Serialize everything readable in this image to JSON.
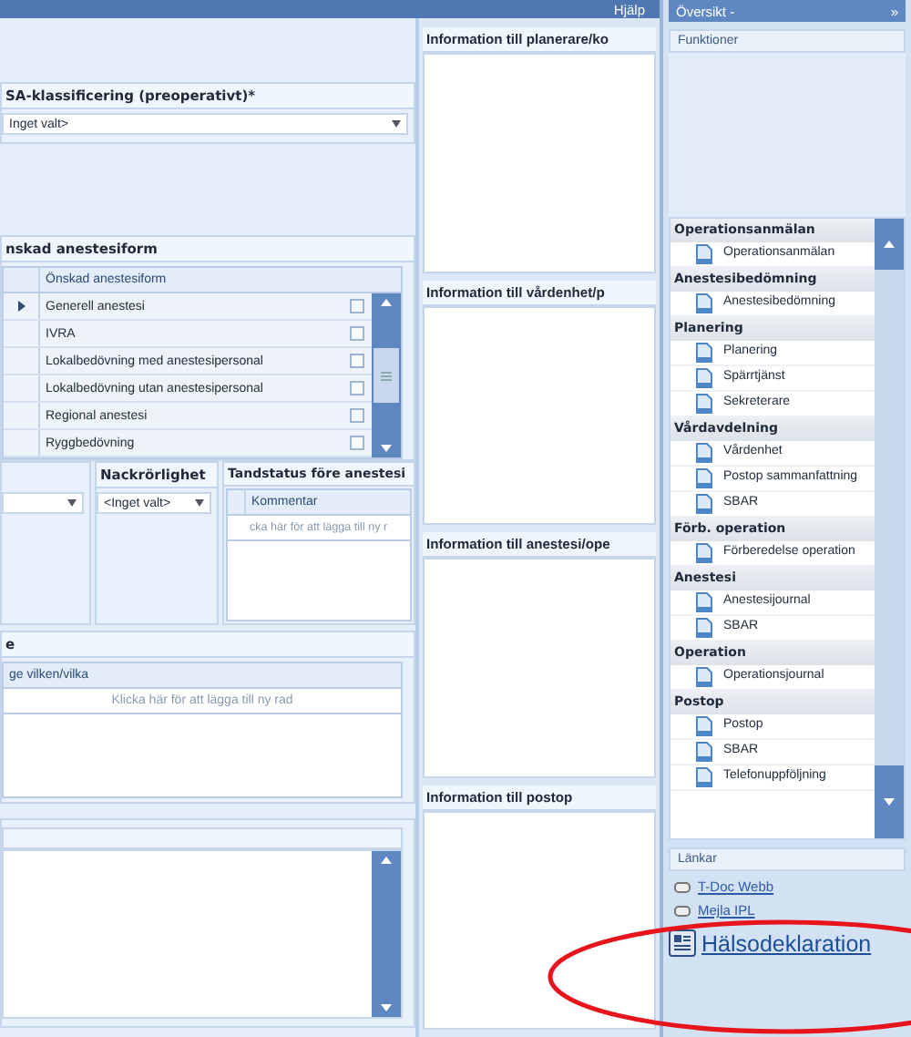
{
  "title_bar": {
    "menu": "Hjälp"
  },
  "asa": {
    "label": "SA-klassificering (preoperativt)*",
    "value": "Inget valt>"
  },
  "anesthesia_form": {
    "label": "nskad anestesiform",
    "column": "Önskad anestesiform",
    "rows": [
      {
        "name": "Generell anestesi",
        "current": true,
        "checked": false
      },
      {
        "name": "IVRA",
        "current": false,
        "checked": false
      },
      {
        "name": "Lokalbedövning med anestesipersonal",
        "current": false,
        "checked": false
      },
      {
        "name": "Lokalbedövning utan anestesipersonal",
        "current": false,
        "checked": false
      },
      {
        "name": "Regional anestesi",
        "current": false,
        "checked": false
      },
      {
        "name": "Ryggbedövning",
        "current": false,
        "checked": false
      }
    ]
  },
  "neck": {
    "label": "Nackrörlighet",
    "value": "<Inget valt>"
  },
  "teeth": {
    "label": "Tandstatus före anestesi",
    "column": "Kommentar",
    "new_row": "cka här för att lägga till ny r"
  },
  "section_e": {
    "label": "e",
    "column": "ge vilken/vilka",
    "new_row": "Klicka här för att lägga till ny rad"
  },
  "info_panels": [
    {
      "title": "Information till planerare/ko"
    },
    {
      "title": "Information till vårdenhet/p"
    },
    {
      "title": "Information till anestesi/ope"
    },
    {
      "title": "Information till postop"
    }
  ],
  "sidebar": {
    "header": "Översikt -",
    "expand": "»",
    "functions": "Funktioner",
    "groups": [
      {
        "title": "Operationsanmälan",
        "items": [
          "Operationsanmälan"
        ]
      },
      {
        "title": "Anestesibedömning",
        "items": [
          "Anestesibedömning"
        ]
      },
      {
        "title": "Planering",
        "items": [
          "Planering",
          "Spärrtjänst",
          "Sekreterare"
        ]
      },
      {
        "title": "Vårdavdelning",
        "items": [
          "Vårdenhet",
          "Postop sammanfattning",
          "SBAR"
        ]
      },
      {
        "title": "Förb. operation",
        "items": [
          "Förberedelse operation"
        ]
      },
      {
        "title": "Anestesi",
        "items": [
          "Anestesijournal",
          "SBAR"
        ]
      },
      {
        "title": "Operation",
        "items": [
          "Operationsjournal"
        ]
      },
      {
        "title": "Postop",
        "items": [
          "Postop",
          "SBAR",
          "Telefonuppföljning"
        ]
      }
    ],
    "links_title": "Länkar",
    "links": [
      {
        "label": "T-Doc Webb"
      },
      {
        "label": "Mejla IPL"
      }
    ],
    "featured_link": "Hälsodeklaration"
  }
}
